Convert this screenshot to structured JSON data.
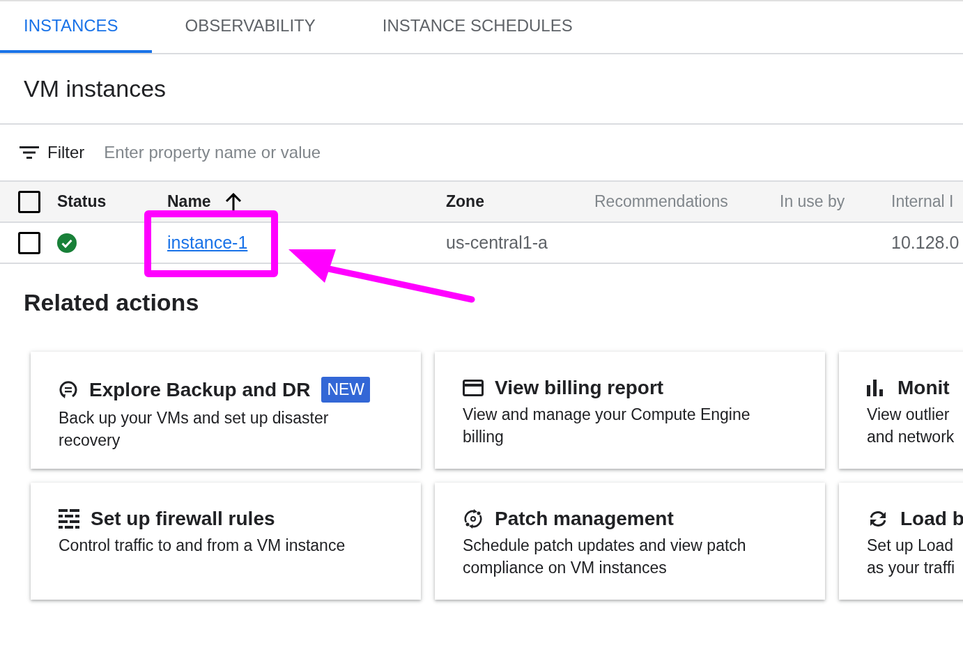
{
  "tabs": [
    {
      "label": "INSTANCES",
      "selected": true
    },
    {
      "label": "OBSERVABILITY",
      "selected": false
    },
    {
      "label": "INSTANCE SCHEDULES",
      "selected": false
    }
  ],
  "page_title": "VM instances",
  "filter": {
    "label": "Filter",
    "placeholder": "Enter property name or value"
  },
  "table": {
    "select_all_checked": false,
    "columns": [
      {
        "label": "Status",
        "sortable": true,
        "sorted": false
      },
      {
        "label": "Name",
        "sortable": true,
        "sorted": true
      },
      {
        "label": "Zone",
        "sortable": true,
        "sorted": false
      },
      {
        "label": "Recommendations",
        "sortable": false,
        "sorted": false
      },
      {
        "label": "In use by",
        "sortable": false,
        "sorted": false
      },
      {
        "label": "Internal I",
        "sortable": false,
        "sorted": false
      }
    ],
    "rows": [
      {
        "checked": false,
        "status": {
          "kind": "running"
        },
        "name": "instance-1",
        "zone": "us-central1-a",
        "internal_ip": "10.128.0"
      }
    ]
  },
  "related_actions": {
    "title": "Related actions",
    "cards": [
      {
        "kind": "backup",
        "title": "Explore Backup and DR",
        "badge": "NEW",
        "description": "Back up your VMs and set up disaster recovery"
      },
      {
        "kind": "billing",
        "title": "View billing report",
        "description": "View and manage your Compute Engine billing"
      },
      {
        "kind": "monitoring",
        "title": "Monit",
        "description_lines": [
          "View outlier",
          "and network"
        ]
      },
      {
        "kind": "firewall",
        "title": "Set up firewall rules",
        "description": "Control traffic to and from a VM instance"
      },
      {
        "kind": "patch",
        "title": "Patch management",
        "description": "Schedule patch updates and view patch compliance on VM instances"
      },
      {
        "kind": "load_balancing",
        "title": "Load b",
        "description_lines": [
          "Set up Load",
          "as your traffi"
        ]
      }
    ]
  }
}
